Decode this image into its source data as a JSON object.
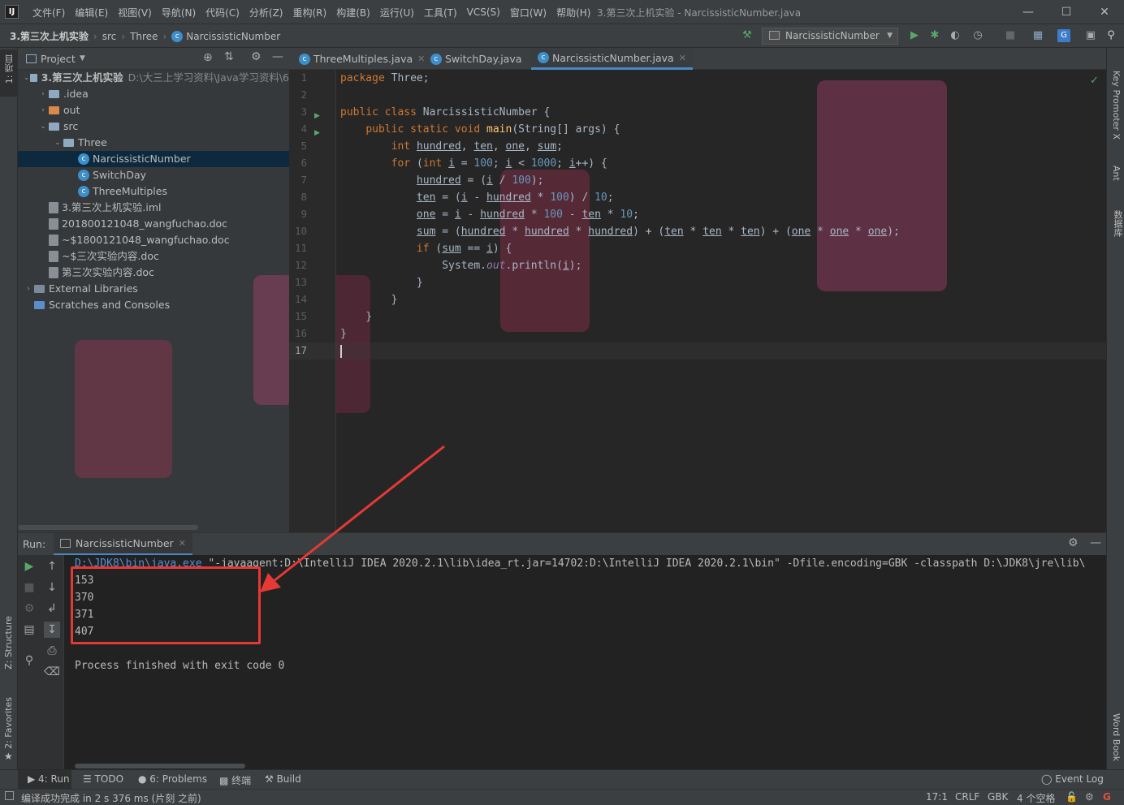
{
  "app": {
    "logo": "IJ",
    "window_title": "3.第三次上机实验 - NarcissisticNumber.java",
    "menu": [
      "文件(F)",
      "编辑(E)",
      "视图(V)",
      "导航(N)",
      "代码(C)",
      "分析(Z)",
      "重构(R)",
      "构建(B)",
      "运行(U)",
      "工具(T)",
      "VCS(S)",
      "窗口(W)",
      "帮助(H)"
    ]
  },
  "nav": {
    "crumbs": [
      "3.第三次上机实验",
      "src",
      "Three",
      "NarcissisticNumber"
    ],
    "run_config": "NarcissisticNumber"
  },
  "left_strip": {
    "project": "1: 项目",
    "structure": "Z: Structure",
    "favorites": "2: Favorites"
  },
  "right_strip": {
    "key_promoter": "Key Promoter X",
    "ant": "Ant",
    "database": "数据库",
    "word_book": "Word Book"
  },
  "project": {
    "title": "Project",
    "tree": [
      {
        "label": "3.第三次上机实验",
        "extra": "D:\\大三上学习资料\\Java学习资料\\6",
        "indent": 0,
        "arrow": "down",
        "icon": "module"
      },
      {
        "label": ".idea",
        "indent": 1,
        "arrow": "right",
        "icon": "folder"
      },
      {
        "label": "out",
        "indent": 1,
        "arrow": "right",
        "icon": "folder-orange"
      },
      {
        "label": "src",
        "indent": 1,
        "arrow": "down",
        "icon": "folder"
      },
      {
        "label": "Three",
        "indent": 2,
        "arrow": "down",
        "icon": "folder"
      },
      {
        "label": "NarcissisticNumber",
        "indent": 3,
        "arrow": "",
        "icon": "class",
        "selected": true
      },
      {
        "label": "SwitchDay",
        "indent": 3,
        "arrow": "",
        "icon": "class"
      },
      {
        "label": "ThreeMultiples",
        "indent": 3,
        "arrow": "",
        "icon": "class"
      },
      {
        "label": "3.第三次上机实验.iml",
        "indent": 1,
        "arrow": "",
        "icon": "doc"
      },
      {
        "label": "201800121048_wangfuchao.doc",
        "indent": 1,
        "arrow": "",
        "icon": "doc"
      },
      {
        "label": "~$1800121048_wangfuchao.doc",
        "indent": 1,
        "arrow": "",
        "icon": "doc"
      },
      {
        "label": "~$三次实验内容.doc",
        "indent": 1,
        "arrow": "",
        "icon": "doc"
      },
      {
        "label": "第三次实验内容.doc",
        "indent": 1,
        "arrow": "",
        "icon": "doc"
      },
      {
        "label": "External Libraries",
        "indent": 0,
        "arrow": "right",
        "icon": "lib"
      },
      {
        "label": "Scratches and Consoles",
        "indent": 0,
        "arrow": "",
        "icon": "scratch"
      }
    ]
  },
  "editor": {
    "tabs": [
      {
        "label": "ThreeMultiples.java",
        "active": false
      },
      {
        "label": "SwitchDay.java",
        "active": false
      },
      {
        "label": "NarcissisticNumber.java",
        "active": true
      }
    ],
    "line_numbers": [
      "1",
      "2",
      "3",
      "4",
      "5",
      "6",
      "7",
      "8",
      "9",
      "10",
      "11",
      "12",
      "13",
      "14",
      "15",
      "16",
      "17"
    ]
  },
  "run": {
    "label": "Run:",
    "tab": "NarcissisticNumber",
    "command_exe": "D:\\JDK8\\bin\\java.exe",
    "command_args": " \"-javaagent:D:\\IntelliJ IDEA 2020.2.1\\lib\\idea_rt.jar=14702:D:\\IntelliJ IDEA 2020.2.1\\bin\" -Dfile.encoding=GBK -classpath D:\\JDK8\\jre\\lib\\",
    "output": [
      "153",
      "370",
      "371",
      "407"
    ],
    "exit_message": "Process finished with exit code 0"
  },
  "bottom_tabs": {
    "run": "4: Run",
    "todo": "TODO",
    "problems": "6: Problems",
    "terminal": "终端",
    "build": "Build",
    "event_log": "Event Log"
  },
  "status": {
    "message": "编译成功完成 in 2 s 376 ms (片刻 之前)",
    "position": "17:1",
    "line_sep": "CRLF",
    "encoding": "GBK",
    "indent": "4 个空格"
  },
  "colors": {
    "accent": "#4a88c7",
    "highlight_box": "#e53935",
    "keyword": "#cc7832",
    "number": "#6897bb"
  }
}
